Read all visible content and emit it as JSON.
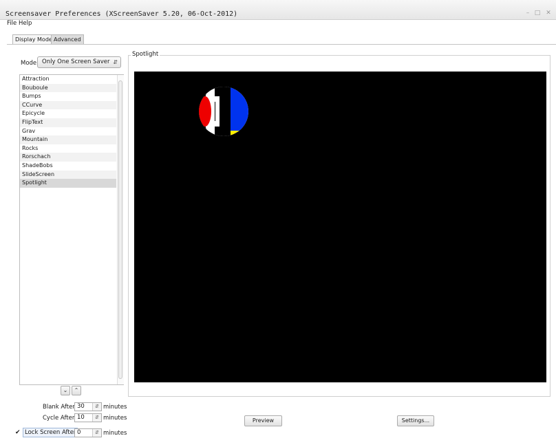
{
  "window": {
    "title": "Screensaver Preferences  (XScreenSaver 5.20, 06-Oct-2012)",
    "controls": [
      "minimize-icon",
      "maximize-icon",
      "close-icon"
    ]
  },
  "menubar": {
    "file": "File",
    "help": "Help"
  },
  "tabs": [
    {
      "label": "Display Modes",
      "active": true
    },
    {
      "label": "Advanced",
      "active": false
    }
  ],
  "mode": {
    "label": "Mode:",
    "value": "Only One Screen Saver"
  },
  "savers": [
    "Attraction",
    "Bouboule",
    "Bumps",
    "CCurve",
    "Epicycle",
    "FlipText",
    "Grav",
    "Mountain",
    "Rocks",
    "Rorschach",
    "ShadeBobs",
    "SlideScreen",
    "Spotlight"
  ],
  "selected_saver": "Spotlight",
  "preview": {
    "frame_title": "Spotlight",
    "background": "#000000"
  },
  "timers": {
    "blank_label": "Blank After",
    "blank_value": "30",
    "cycle_label": "Cycle After",
    "cycle_value": "10",
    "lock_label": "Lock Screen After",
    "lock_value": "0",
    "lock_checked": true,
    "units": "minutes"
  },
  "buttons": {
    "preview": "Preview",
    "settings": "Settings..."
  },
  "colors": {
    "accent_blue": "#0033ee",
    "accent_red": "#ee0000",
    "accent_yellow": "#ffee00"
  }
}
